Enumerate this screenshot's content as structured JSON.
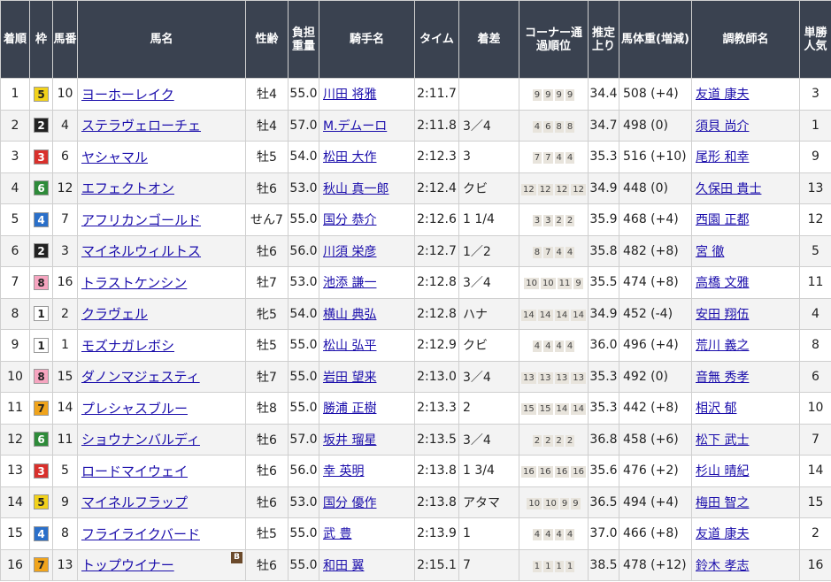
{
  "headers": {
    "rank": "着順",
    "waku": "枠",
    "umaban": "馬番",
    "horse": "馬名",
    "sexage": "性齢",
    "weight": "負担重量",
    "jockey": "騎手名",
    "time": "タイム",
    "margin": "着差",
    "corner": "コーナー通過順位",
    "last3f": "推定上り",
    "bodyweight": "馬体重(増減)",
    "trainer": "調教師名",
    "popularity": "単勝人気"
  },
  "waku_colors": {
    "1": {
      "bg": "#ffffff",
      "fg": "#222222"
    },
    "2": {
      "bg": "#222222",
      "fg": "#ffffff"
    },
    "3": {
      "bg": "#d9302c",
      "fg": "#ffffff"
    },
    "4": {
      "bg": "#2a6fc9",
      "fg": "#ffffff"
    },
    "5": {
      "bg": "#f2d21b",
      "fg": "#222222"
    },
    "6": {
      "bg": "#2e8b3a",
      "fg": "#ffffff"
    },
    "7": {
      "bg": "#f0a41c",
      "fg": "#222222"
    },
    "8": {
      "bg": "#f6a5c0",
      "fg": "#222222"
    }
  },
  "rows": [
    {
      "rank": "1",
      "waku": "5",
      "umaban": "10",
      "horse": "ヨーホーレイク",
      "blinker": "",
      "sexage": "牡4",
      "weight": "55.0",
      "jockey": "川田 将雅",
      "time": "2:11.7",
      "margin": "",
      "corner": [
        "9",
        "9",
        "9",
        "9"
      ],
      "last3f": "34.4",
      "bodyweight": "508 (+4)",
      "trainer": "友道 康夫",
      "popularity": "3"
    },
    {
      "rank": "2",
      "waku": "2",
      "umaban": "4",
      "horse": "ステラヴェローチェ",
      "blinker": "",
      "sexage": "牡4",
      "weight": "57.0",
      "jockey": "M.デムーロ",
      "time": "2:11.8",
      "margin": "3／4",
      "corner": [
        "4",
        "6",
        "8",
        "8"
      ],
      "last3f": "34.7",
      "bodyweight": "498 (0)",
      "trainer": "須貝 尚介",
      "popularity": "1"
    },
    {
      "rank": "3",
      "waku": "3",
      "umaban": "6",
      "horse": "ヤシャマル",
      "blinker": "",
      "sexage": "牡5",
      "weight": "54.0",
      "jockey": "松田 大作",
      "time": "2:12.3",
      "margin": "3",
      "corner": [
        "7",
        "7",
        "4",
        "4"
      ],
      "last3f": "35.3",
      "bodyweight": "516 (+10)",
      "trainer": "尾形 和幸",
      "popularity": "9"
    },
    {
      "rank": "4",
      "waku": "6",
      "umaban": "12",
      "horse": "エフェクトオン",
      "blinker": "",
      "sexage": "牡6",
      "weight": "53.0",
      "jockey": "秋山 真一郎",
      "time": "2:12.4",
      "margin": "クビ",
      "corner": [
        "12",
        "12",
        "12",
        "12"
      ],
      "last3f": "34.9",
      "bodyweight": "448 (0)",
      "trainer": "久保田 貴士",
      "popularity": "13"
    },
    {
      "rank": "5",
      "waku": "4",
      "umaban": "7",
      "horse": "アフリカンゴールド",
      "blinker": "",
      "sexage": "せん7",
      "weight": "55.0",
      "jockey": "国分 恭介",
      "time": "2:12.6",
      "margin": "1 1/4",
      "corner": [
        "3",
        "3",
        "2",
        "2"
      ],
      "last3f": "35.9",
      "bodyweight": "468 (+4)",
      "trainer": "西園 正都",
      "popularity": "12"
    },
    {
      "rank": "6",
      "waku": "2",
      "umaban": "3",
      "horse": "マイネルウィルトス",
      "blinker": "",
      "sexage": "牡6",
      "weight": "56.0",
      "jockey": "川須 栄彦",
      "time": "2:12.7",
      "margin": "1／2",
      "corner": [
        "8",
        "7",
        "4",
        "4"
      ],
      "last3f": "35.8",
      "bodyweight": "482 (+8)",
      "trainer": "宮 徹",
      "popularity": "5"
    },
    {
      "rank": "7",
      "waku": "8",
      "umaban": "16",
      "horse": "トラストケンシン",
      "blinker": "",
      "sexage": "牡7",
      "weight": "53.0",
      "jockey": "池添 謙一",
      "time": "2:12.8",
      "margin": "3／4",
      "corner": [
        "10",
        "10",
        "11",
        "9"
      ],
      "last3f": "35.5",
      "bodyweight": "474 (+8)",
      "trainer": "高橋 文雅",
      "popularity": "11"
    },
    {
      "rank": "8",
      "waku": "1",
      "umaban": "2",
      "horse": "クラヴェル",
      "blinker": "",
      "sexage": "牝5",
      "weight": "54.0",
      "jockey": "横山 典弘",
      "time": "2:12.8",
      "margin": "ハナ",
      "corner": [
        "14",
        "14",
        "14",
        "14"
      ],
      "last3f": "34.9",
      "bodyweight": "452 (-4)",
      "trainer": "安田 翔伍",
      "popularity": "4"
    },
    {
      "rank": "9",
      "waku": "1",
      "umaban": "1",
      "horse": "モズナガレボシ",
      "blinker": "",
      "sexage": "牡5",
      "weight": "55.0",
      "jockey": "松山 弘平",
      "time": "2:12.9",
      "margin": "クビ",
      "corner": [
        "4",
        "4",
        "4",
        "4"
      ],
      "last3f": "36.0",
      "bodyweight": "496 (+4)",
      "trainer": "荒川 義之",
      "popularity": "8"
    },
    {
      "rank": "10",
      "waku": "8",
      "umaban": "15",
      "horse": "ダノンマジェスティ",
      "blinker": "",
      "sexage": "牡7",
      "weight": "55.0",
      "jockey": "岩田 望来",
      "time": "2:13.0",
      "margin": "3／4",
      "corner": [
        "13",
        "13",
        "13",
        "13"
      ],
      "last3f": "35.3",
      "bodyweight": "492 (0)",
      "trainer": "音無 秀孝",
      "popularity": "6"
    },
    {
      "rank": "11",
      "waku": "7",
      "umaban": "14",
      "horse": "プレシャスブルー",
      "blinker": "",
      "sexage": "牡8",
      "weight": "55.0",
      "jockey": "勝浦 正樹",
      "time": "2:13.3",
      "margin": "2",
      "corner": [
        "15",
        "15",
        "14",
        "14"
      ],
      "last3f": "35.3",
      "bodyweight": "442 (+8)",
      "trainer": "相沢 郁",
      "popularity": "10"
    },
    {
      "rank": "12",
      "waku": "6",
      "umaban": "11",
      "horse": "ショウナンバルディ",
      "blinker": "",
      "sexage": "牡6",
      "weight": "57.0",
      "jockey": "坂井 瑠星",
      "time": "2:13.5",
      "margin": "3／4",
      "corner": [
        "2",
        "2",
        "2",
        "2"
      ],
      "last3f": "36.8",
      "bodyweight": "458 (+6)",
      "trainer": "松下 武士",
      "popularity": "7"
    },
    {
      "rank": "13",
      "waku": "3",
      "umaban": "5",
      "horse": "ロードマイウェイ",
      "blinker": "",
      "sexage": "牡6",
      "weight": "56.0",
      "jockey": "幸 英明",
      "time": "2:13.8",
      "margin": "1 3/4",
      "corner": [
        "16",
        "16",
        "16",
        "16"
      ],
      "last3f": "35.6",
      "bodyweight": "476 (+2)",
      "trainer": "杉山 晴紀",
      "popularity": "14"
    },
    {
      "rank": "14",
      "waku": "5",
      "umaban": "9",
      "horse": "マイネルフラップ",
      "blinker": "",
      "sexage": "牡6",
      "weight": "53.0",
      "jockey": "国分 優作",
      "time": "2:13.8",
      "margin": "アタマ",
      "corner": [
        "10",
        "10",
        "9",
        "9"
      ],
      "last3f": "36.5",
      "bodyweight": "494 (+4)",
      "trainer": "梅田 智之",
      "popularity": "15"
    },
    {
      "rank": "15",
      "waku": "4",
      "umaban": "8",
      "horse": "フライライクバード",
      "blinker": "",
      "sexage": "牡5",
      "weight": "55.0",
      "jockey": "武 豊",
      "time": "2:13.9",
      "margin": "1",
      "corner": [
        "4",
        "4",
        "4",
        "4"
      ],
      "last3f": "37.0",
      "bodyweight": "466 (+8)",
      "trainer": "友道 康夫",
      "popularity": "2"
    },
    {
      "rank": "16",
      "waku": "7",
      "umaban": "13",
      "horse": "トップウイナー",
      "blinker": "B",
      "sexage": "牡6",
      "weight": "55.0",
      "jockey": "和田 翼",
      "time": "2:15.1",
      "margin": "7",
      "corner": [
        "1",
        "1",
        "1",
        "1"
      ],
      "last3f": "38.5",
      "bodyweight": "478 (+12)",
      "trainer": "鈴木 孝志",
      "popularity": "16"
    }
  ]
}
